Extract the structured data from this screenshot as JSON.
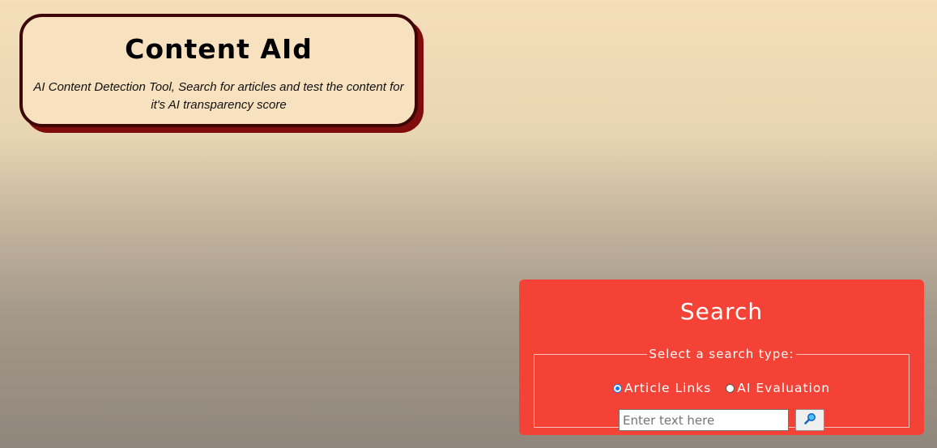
{
  "header": {
    "title": "Content AId",
    "subtitle": "AI Content Detection Tool, Search for articles and test the content for it's AI transparency score"
  },
  "search": {
    "title": "Search",
    "legend": "Select a search type:",
    "options": [
      {
        "label": "Article Links",
        "checked": true
      },
      {
        "label": "AI Evaluation",
        "checked": false
      }
    ],
    "input_placeholder": "Enter text here",
    "input_value": "",
    "button_icon": "magnifier-icon"
  },
  "colors": {
    "panel_bg": "#f44336",
    "header_card_bg": "#f7e1be",
    "header_border": "#3e0707",
    "header_shadow": "#800d0d",
    "radio_accent": "#1a73e8",
    "search_icon_blue": "#1e88e5"
  }
}
